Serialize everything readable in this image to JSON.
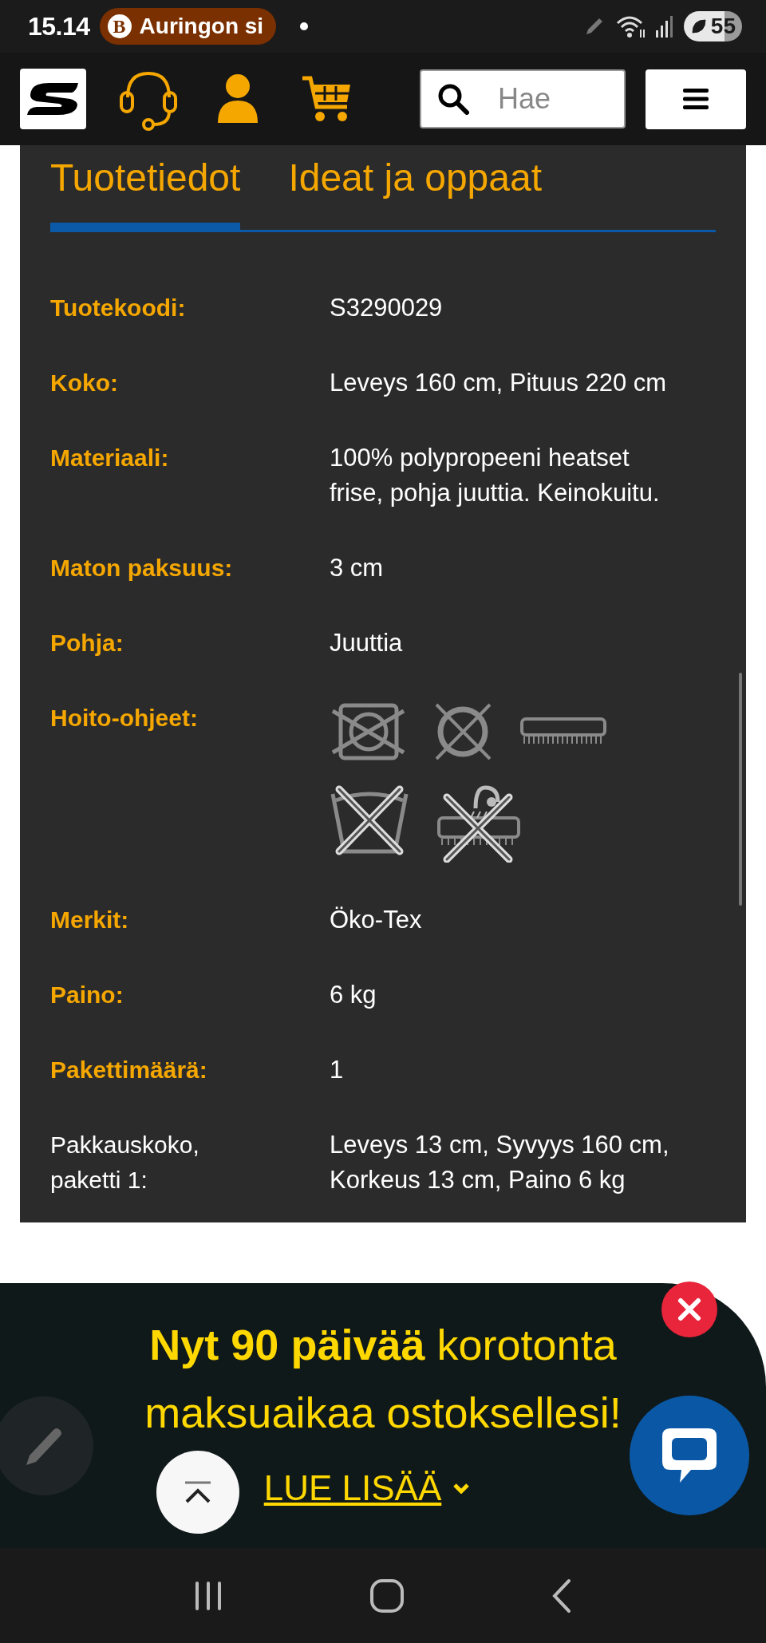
{
  "status_bar": {
    "time": "15.14",
    "notification": {
      "app_letter": "B",
      "text": "Auringon si"
    },
    "battery": "55"
  },
  "header": {
    "search": {
      "placeholder": "Hae"
    }
  },
  "tabs": [
    {
      "label": "Tuotetiedot",
      "selected": true
    },
    {
      "label": "Ideat ja oppaat",
      "selected": false
    }
  ],
  "details": [
    {
      "kind": "text",
      "label": "Tuotekoodi:",
      "emphasized": true,
      "value": "S3290029"
    },
    {
      "kind": "text",
      "label": "Koko:",
      "emphasized": true,
      "value": "Leveys 160 cm, Pituus 220 cm"
    },
    {
      "kind": "text",
      "label": "Materiaali:",
      "emphasized": true,
      "value": "100% polypropeeni heatset frise, pohja juuttia. Keinokuitu."
    },
    {
      "kind": "text",
      "label": "Maton paksuus:",
      "emphasized": true,
      "value": "3 cm"
    },
    {
      "kind": "text",
      "label": "Pohja:",
      "emphasized": true,
      "value": "Juuttia"
    },
    {
      "kind": "care_icons",
      "label": "Hoito-ohjeet:",
      "emphasized": true
    },
    {
      "kind": "text",
      "label": "Merkit:",
      "emphasized": true,
      "value": "Öko-Tex"
    },
    {
      "kind": "text",
      "label": "Paino:",
      "emphasized": true,
      "value": "6 kg"
    },
    {
      "kind": "text",
      "label": "Pakettimäärä:",
      "emphasized": true,
      "value": "1"
    },
    {
      "kind": "text",
      "label": "Pakkauskoko, paketti 1:",
      "emphasized": false,
      "value": "Leveys 13 cm, Syvyys 160 cm, Korkeus 13 cm, Paino 6 kg"
    }
  ],
  "banner": {
    "headline": "**Nyt 90 päivää** korotonta maksuaikaa ostoksellesi!",
    "link": "LUE LISÄÄ"
  }
}
